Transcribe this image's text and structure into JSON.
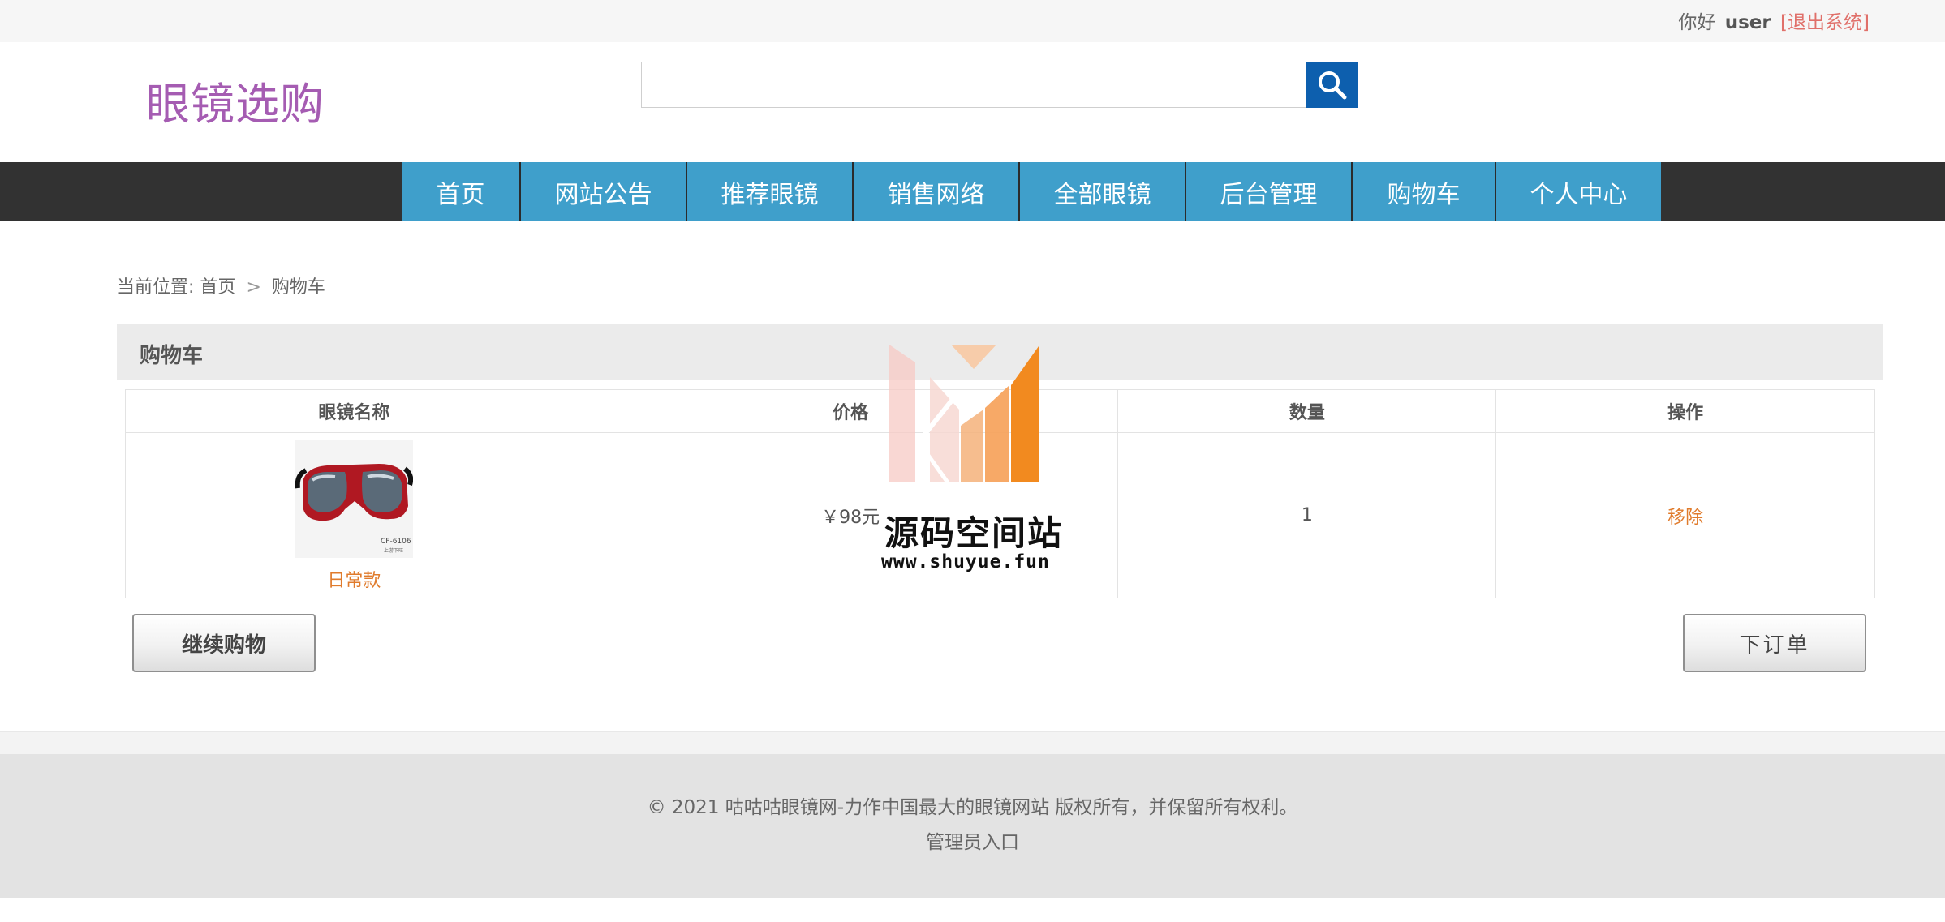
{
  "topbar": {
    "greeting": "你好",
    "username": "user",
    "logout": "[退出系统]"
  },
  "header": {
    "logo": "眼镜选购",
    "search": {
      "value": "",
      "placeholder": ""
    },
    "search_icon": "search-icon"
  },
  "nav": {
    "items": [
      {
        "label": "首页"
      },
      {
        "label": "网站公告"
      },
      {
        "label": "推荐眼镜"
      },
      {
        "label": "销售网络"
      },
      {
        "label": "全部眼镜"
      },
      {
        "label": "后台管理"
      },
      {
        "label": "购物车"
      },
      {
        "label": "个人中心"
      }
    ]
  },
  "breadcrumb": {
    "prefix": "当前位置:",
    "home": "首页",
    "separator": ">",
    "current": "购物车"
  },
  "cart": {
    "title": "购物车",
    "columns": [
      "眼镜名称",
      "价格",
      "数量",
      "操作"
    ],
    "rows": [
      {
        "name": "日常款",
        "image_caption_line1": "CF-6106",
        "image_caption_line2": "上游下旺",
        "price": "￥98元",
        "quantity": "1",
        "action": "移除"
      }
    ],
    "continue_button": "继续购物",
    "order_button": "下订单"
  },
  "footer": {
    "copyright": "© 2021 咕咕咕眼镜网-力作中国最大的眼镜网站 版权所有，并保留所有权利。",
    "admin_link": "管理员入口"
  },
  "watermark": {
    "text": "源码空间站",
    "url": "www.shuyue.fun"
  },
  "colors": {
    "nav_bg": "#3f9fcb",
    "nav_bar": "#323232",
    "logo": "#a55cb2",
    "accent_orange": "#e07b2c",
    "search_button": "#0d5fae",
    "logout": "#e0706a"
  }
}
